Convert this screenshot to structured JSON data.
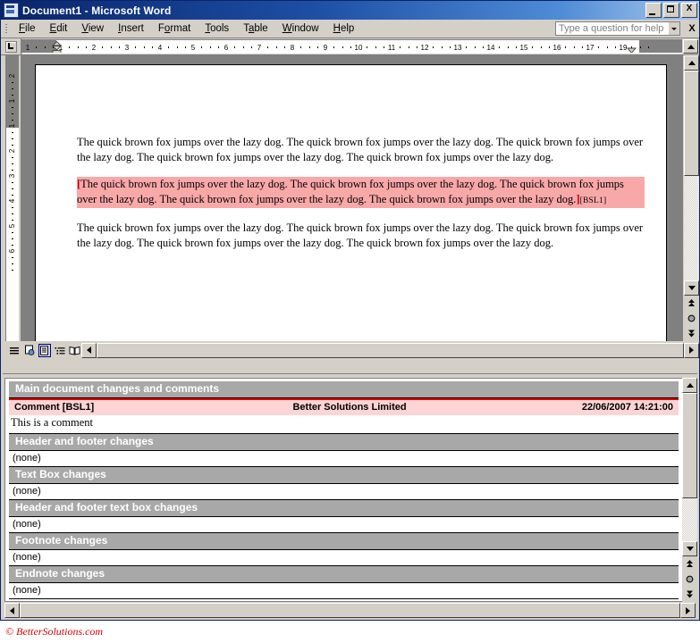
{
  "window": {
    "title": "Document1 - Microsoft Word",
    "app_icon": "word-document-icon",
    "minimize_label": "",
    "maximize_label": "",
    "close_label": "X"
  },
  "menubar": {
    "items": [
      {
        "label": "File",
        "mnemonic": "F"
      },
      {
        "label": "Edit",
        "mnemonic": "E"
      },
      {
        "label": "View",
        "mnemonic": "V"
      },
      {
        "label": "Insert",
        "mnemonic": "I"
      },
      {
        "label": "Format",
        "mnemonic": "o"
      },
      {
        "label": "Tools",
        "mnemonic": "T"
      },
      {
        "label": "Table",
        "mnemonic": "a"
      },
      {
        "label": "Window",
        "mnemonic": "W"
      },
      {
        "label": "Help",
        "mnemonic": "H"
      }
    ],
    "ask_a_question": {
      "placeholder": "Type a question for help",
      "value": ""
    },
    "close_document_label": "X"
  },
  "ruler": {
    "horizontal": {
      "unit": "cm",
      "ticks": [
        "1",
        "1",
        "2",
        "3",
        "4",
        "5",
        "6",
        "7",
        "8",
        "9",
        "10",
        "11",
        "12",
        "13",
        "14",
        "15",
        "16",
        "17",
        "19"
      ],
      "left_indent_marker": "indent-marker",
      "right_indent_marker": "indent-marker"
    },
    "vertical": {
      "unit": "cm",
      "ticks": [
        "2",
        "1",
        "1",
        "2",
        "3",
        "4",
        "5",
        "6"
      ]
    },
    "tab_selector": "left-tab-stop-icon"
  },
  "document": {
    "paragraphs": [
      {
        "id": "para-1",
        "highlighted": false,
        "text": "The quick brown fox jumps over the lazy dog.   The quick brown fox jumps over the lazy dog.   The quick brown fox jumps over the lazy dog.   The quick brown fox jumps over the lazy dog.   The quick brown fox jumps over the lazy dog."
      },
      {
        "id": "para-2",
        "highlighted": true,
        "open_bracket": "[",
        "close_bracket": "]",
        "comment_ref": "[BSL1]",
        "text": "The quick brown fox jumps over the lazy dog.   The quick brown fox jumps over the lazy dog.   The quick brown fox jumps over the lazy dog.   The quick brown fox jumps over the lazy dog.   The quick brown fox jumps over the lazy dog."
      },
      {
        "id": "para-3",
        "highlighted": false,
        "text": "The quick brown fox jumps over the lazy dog.   The quick brown fox jumps over the lazy dog.   The quick brown fox jumps over the lazy dog.   The quick brown fox jumps over the lazy dog.   The quick brown fox jumps over the lazy dog."
      }
    ]
  },
  "view_bar": {
    "buttons": [
      {
        "name": "normal-view-button",
        "icon": "lines-icon",
        "selected": false
      },
      {
        "name": "web-layout-view-button",
        "icon": "globe-page-icon",
        "selected": false
      },
      {
        "name": "print-layout-view-button",
        "icon": "page-icon",
        "selected": true
      },
      {
        "name": "outline-view-button",
        "icon": "outline-icon",
        "selected": false
      },
      {
        "name": "reading-layout-view-button",
        "icon": "open-book-icon",
        "selected": false
      }
    ]
  },
  "scrollbars": {
    "vertical_up_icon": "arrow-up-icon",
    "vertical_down_icon": "arrow-down-icon",
    "previous_page_icon": "double-arrow-up-icon",
    "select_browse_object_icon": "circle-icon",
    "next_page_icon": "double-arrow-down-icon",
    "horizontal_left_icon": "arrow-left-icon",
    "horizontal_right_icon": "arrow-right-icon"
  },
  "reviewing_pane": {
    "sections": [
      {
        "name": "main-document-changes-section",
        "title": "Main document changes and comments",
        "type": "comments",
        "comments": [
          {
            "label": "Comment [BSL1]",
            "author": "Better Solutions Limited",
            "datetime": "22/06/2007 14:21:00",
            "body": "This is a comment"
          }
        ]
      },
      {
        "name": "header-and-footer-changes-section",
        "title": "Header and footer changes",
        "type": "none",
        "none_text": "(none)"
      },
      {
        "name": "text-box-changes-section",
        "title": "Text Box changes",
        "type": "none",
        "none_text": "(none)"
      },
      {
        "name": "header-and-footer-text-box-changes-section",
        "title": "Header and footer text box changes",
        "type": "none",
        "none_text": "(none)"
      },
      {
        "name": "footnote-changes-section",
        "title": "Footnote changes",
        "type": "none",
        "none_text": "(none)"
      },
      {
        "name": "endnote-changes-section",
        "title": "Endnote changes",
        "type": "none",
        "none_text": "(none)"
      }
    ]
  },
  "footer": {
    "copyright": "© BetterSolutions.com"
  },
  "colors": {
    "titlebar_start": "#0a246a",
    "titlebar_end": "#a8c8ec",
    "chrome": "#d4d0c8",
    "comment_highlight": "#f9a8a8",
    "comment_pane_row": "#fbd5d5",
    "comment_red": "#e00000",
    "section_header": "#a8a8a8",
    "page_background": "#808080",
    "footer_text": "#e00000"
  }
}
